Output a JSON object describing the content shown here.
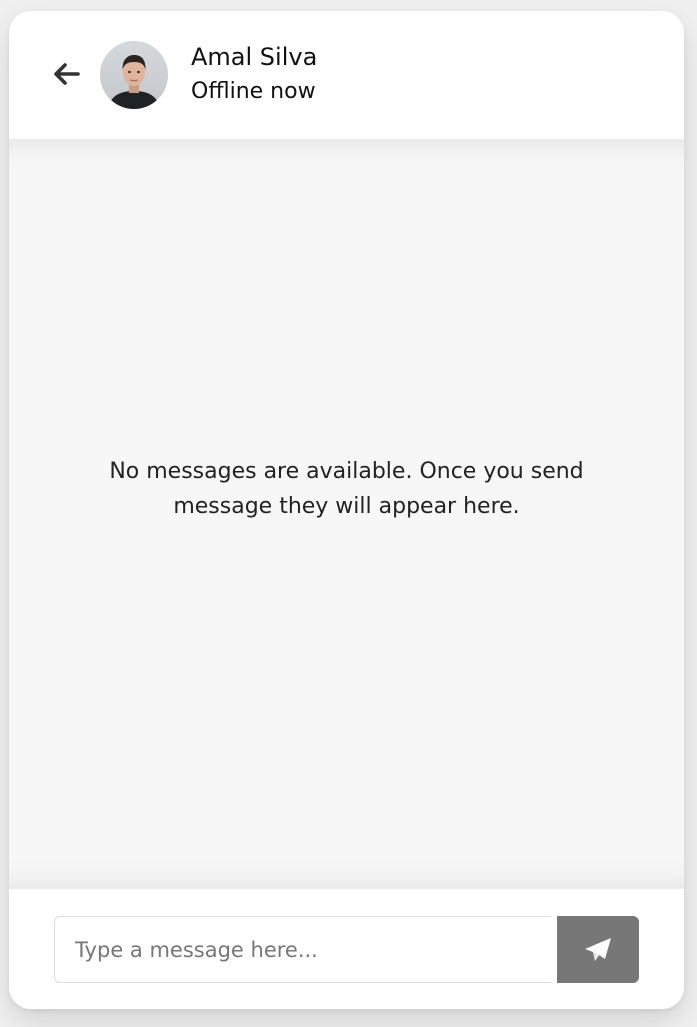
{
  "header": {
    "user_name": "Amal Silva",
    "status": "Offline now",
    "back_icon": "arrow-left-icon",
    "avatar": "user-avatar"
  },
  "chat": {
    "empty_message": "No messages are available. Once you send message they will appear here."
  },
  "typing_area": {
    "input_placeholder": "Type a message here...",
    "input_value": "",
    "send_icon": "paper-plane-icon"
  },
  "colors": {
    "background": "#f0f0f0",
    "card": "#ffffff",
    "chat_background": "#f7f7f7",
    "send_button": "#777777",
    "text": "#111111"
  }
}
